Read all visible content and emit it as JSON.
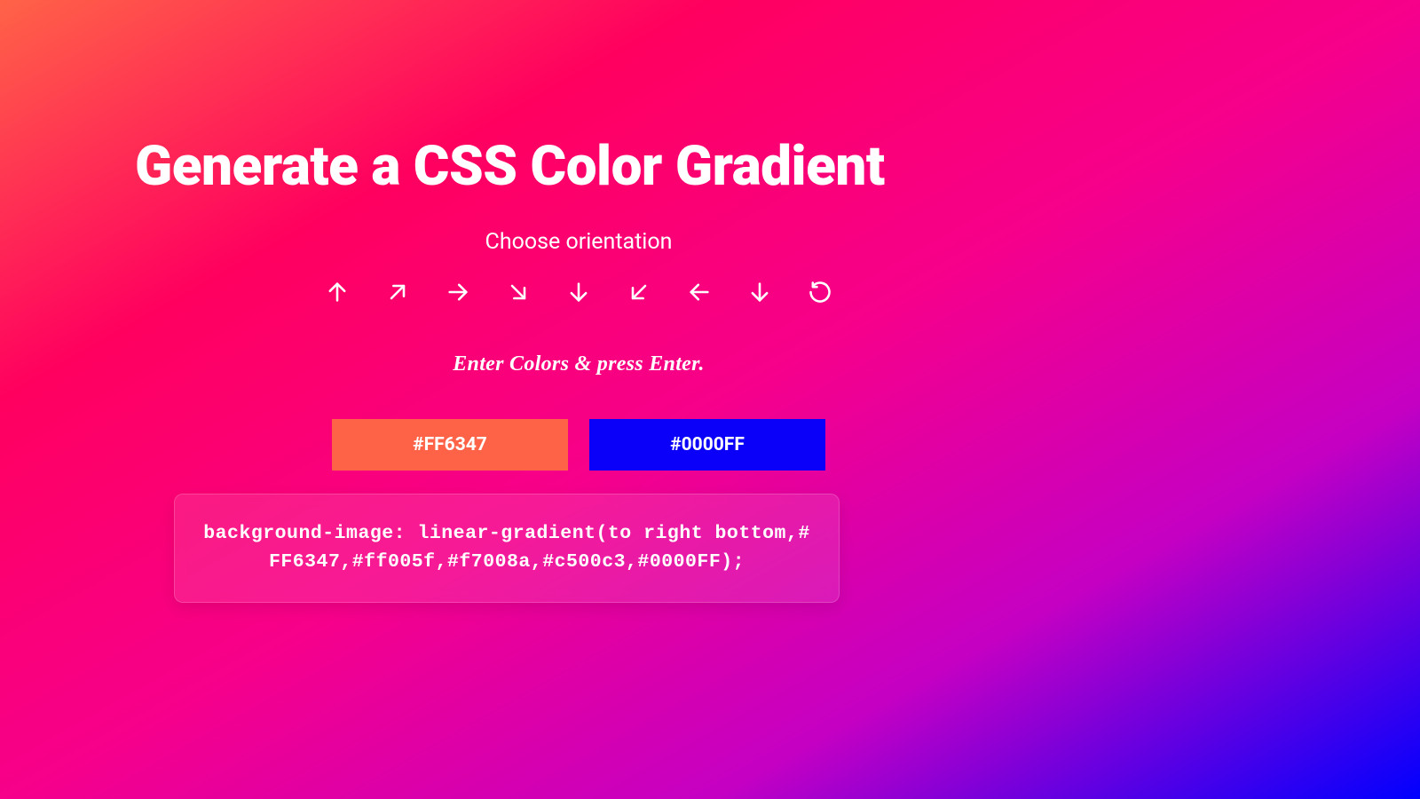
{
  "heading": "Generate a CSS Color Gradient",
  "subtitle": "Choose orientation",
  "orientations": [
    {
      "name": "arrow-up-icon",
      "label": "to top"
    },
    {
      "name": "arrow-up-right-icon",
      "label": "to top right"
    },
    {
      "name": "arrow-right-icon",
      "label": "to right"
    },
    {
      "name": "arrow-down-right-icon",
      "label": "to bottom right"
    },
    {
      "name": "arrow-down-icon",
      "label": "to bottom"
    },
    {
      "name": "arrow-down-left-icon",
      "label": "to bottom left"
    },
    {
      "name": "arrow-left-icon",
      "label": "to left"
    },
    {
      "name": "arrow-down-icon-2",
      "label": "to bottom"
    },
    {
      "name": "rotate-icon",
      "label": "radial"
    }
  ],
  "enter_colors_label": "Enter Colors & press Enter.",
  "color_inputs": {
    "a": {
      "value": "#FF6347",
      "bg": "#FF6347"
    },
    "b": {
      "value": "#0000FF",
      "bg": "#0A00FA"
    }
  },
  "css_output": "background-image: linear-gradient(to right bottom,#FF6347,#ff005f,#f7008a,#c500c3,#0000FF);"
}
